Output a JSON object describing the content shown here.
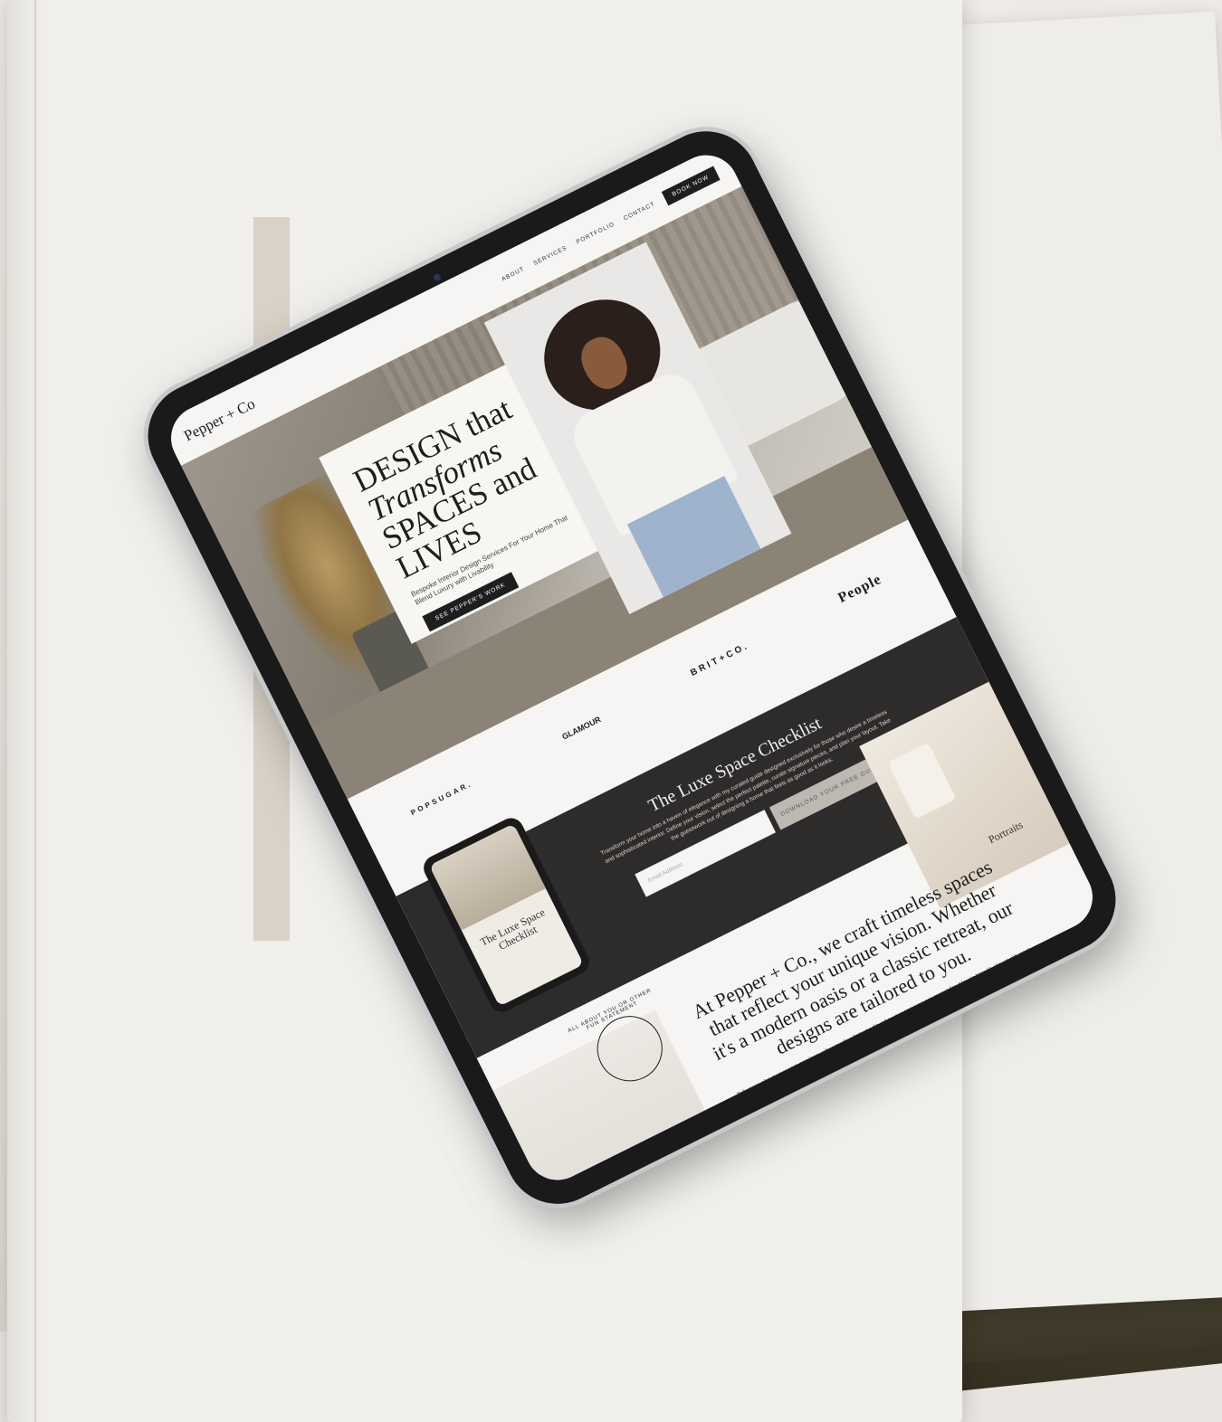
{
  "site": {
    "logo": "Pepper + Co",
    "nav": [
      "ABOUT",
      "SERVICES",
      "PORTFOLIO",
      "CONTACT"
    ],
    "nav_cta": "BOOK NOW"
  },
  "hero": {
    "title_line1": "DESIGN that",
    "title_line2": "Transforms",
    "title_line3": "SPACES and LIVES",
    "subtitle": "Bespoke Interior Design Services For Your Home That Blend Luxury with Livability",
    "button": "SEE PEPPER'S WORK"
  },
  "press": [
    "POPSUGAR.",
    "GLAMOUR",
    "BRIT+CO.",
    "People"
  ],
  "optin": {
    "title": "The Luxe Space Checklist",
    "text": "Transform your home into a haven of elegance with my curated guide designed exclusively for those who desire a timeless and sophisticated interior. Define your vision, select the perfect palette, curate signature pieces, and plan your layout. Take the guesswork out of designing a home that feels as good as it looks.",
    "email_placeholder": "Email Address",
    "button": "DOWNLOAD YOUR FREE GUIDE",
    "mockup_title": "The Luxe Space Checklist"
  },
  "about": {
    "circle_text": "ALL ABOUT YOU OR OTHER FUN STATEMENT",
    "title": "At Pepper + Co., we craft timeless spaces that reflect your unique vision. Whether it's a modern oasis or a classic retreat, our designs are tailored to you.",
    "text": "Talk more about your core services, why you do what you do, who your services are meant for. Mauris blandit aliquet elit, eget tincidunt nibh pulvinar a. Donec sollicitudin molestie malesuada. Cras ultricies ligula sed magna dictum porta. Curabitur arcu erat, accumsan id imperdiet et, porttitor at sem. Vestibulum ante ipsum primis in faucibus orci luctus et ultrices posuere cubilia Curae.",
    "book_label": "Portraits"
  }
}
